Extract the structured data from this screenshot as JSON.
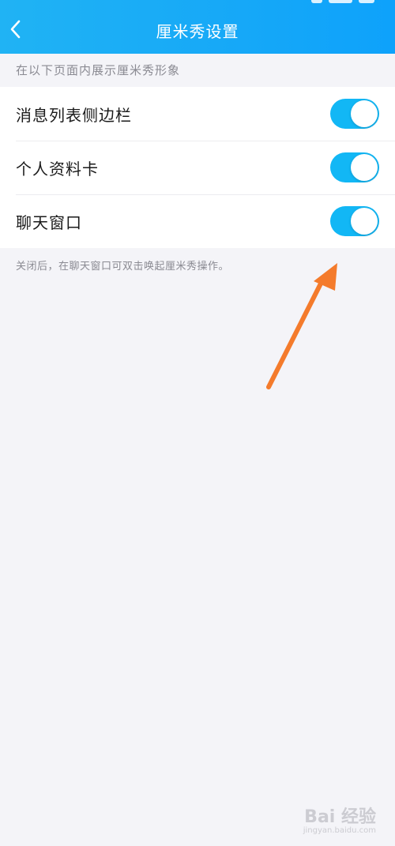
{
  "header": {
    "title": "厘米秀设置",
    "back_icon": "chevron-left-icon",
    "background_colors": [
      "#20b3f4",
      "#0ea2fb"
    ]
  },
  "section": {
    "header_text": "在以下页面内展示厘米秀形象",
    "items": [
      {
        "label": "消息列表侧边栏",
        "toggle_on": true
      },
      {
        "label": "个人资料卡",
        "toggle_on": true
      },
      {
        "label": "聊天窗口",
        "toggle_on": true
      }
    ],
    "footnote": "关闭后，在聊天窗口可双击唤起厘米秀操作。"
  },
  "colors": {
    "toggle_on": "#12b7f5",
    "annotation_arrow": "#f47b2c",
    "page_background": "#f4f4f8"
  },
  "watermark": {
    "logo": "Bai 经验",
    "url": "jingyan.baidu.com"
  }
}
